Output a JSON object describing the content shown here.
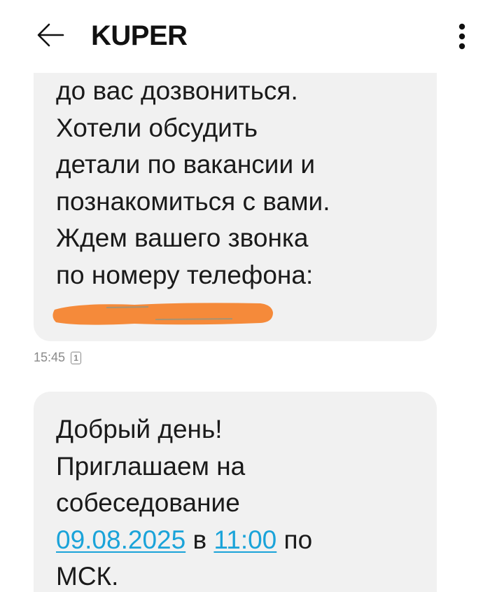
{
  "header": {
    "title": "KUPER",
    "back_icon": "arrow-left-icon",
    "menu_icon": "more-vertical-icon"
  },
  "messages": [
    {
      "lines": [
        "до вас дозвониться.",
        "Хотели обсудить",
        "детали по вакансии и",
        "познакомиться с вами.",
        "Ждем вашего звонка",
        "по номеру телефона:"
      ],
      "redacted_phone_color": "#f58a3a",
      "time": "15:45",
      "sim": "1"
    },
    {
      "line1": "Добрый день!",
      "line2": "Приглашаем на",
      "line3": "собеседование",
      "date_link": "09.08.2025",
      "mid_text": " в ",
      "time_link": "11:00",
      "after_text": " по",
      "line5": "МСК."
    }
  ],
  "colors": {
    "bubble": "#f1f1f1",
    "link": "#1aa3d9",
    "meta": "#8a8a8a"
  }
}
